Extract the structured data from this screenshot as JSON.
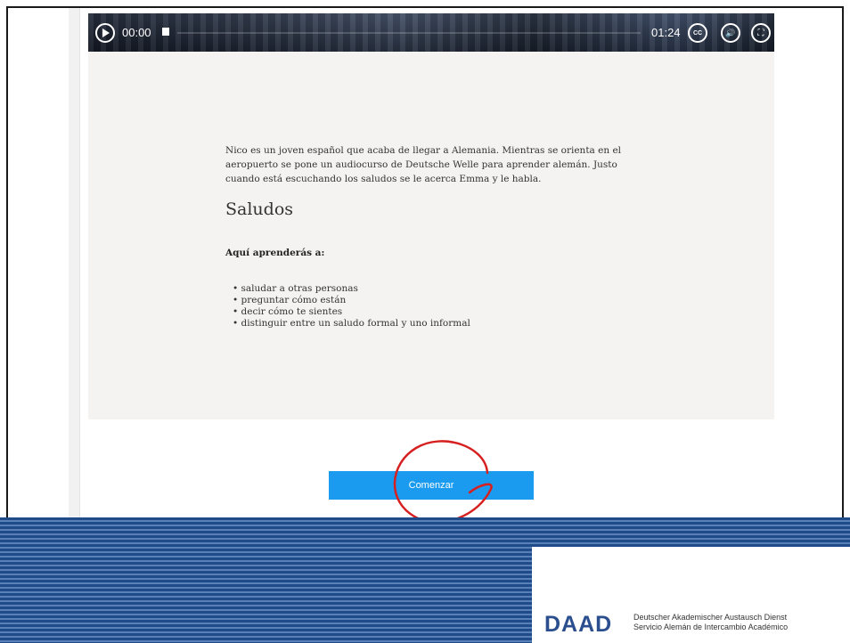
{
  "video": {
    "current_time": "00:00",
    "total_time": "01:24",
    "cc_label": "CC",
    "icons": [
      "play-icon",
      "stop-icon",
      "cc-icon",
      "volume-icon",
      "fullscreen-icon"
    ]
  },
  "lesson": {
    "intro": "Nico es un joven español que acaba de llegar a Alemania. Mientras se orienta en el aeropuerto se pone un audiocurso de Deutsche Welle para aprender alemán. Justo cuando está escuchando los saludos se le acerca Emma y le habla.",
    "title": "Saludos",
    "learn_heading": "Aquí aprenderás a:",
    "goals": [
      "saludar a otras personas",
      "preguntar cómo están",
      "decir cómo te sientes",
      "distinguir entre un saludo formal y uno informal"
    ]
  },
  "start_button": {
    "label": "Comenzar",
    "color": "#1a9bf0"
  },
  "annotation": {
    "color": "#d62020"
  },
  "footer": {
    "logo": "DAAD",
    "name_de": "Deutscher Akademischer Austausch Dienst",
    "name_es": "Servicio Alemán de Intercambio Académico",
    "brand_color": "#2b4f8e"
  }
}
